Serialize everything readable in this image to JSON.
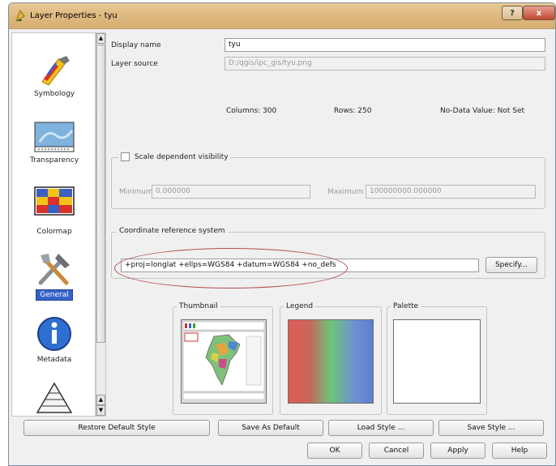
{
  "window": {
    "title": "Layer Properties - tyu",
    "help_glyph": "?",
    "close_glyph": "x"
  },
  "nav": {
    "items": [
      {
        "label": "Symbology",
        "icon": "symbology-brush-icon"
      },
      {
        "label": "Transparency",
        "icon": "transparency-map-icon"
      },
      {
        "label": "Colormap",
        "icon": "colormap-grid-icon"
      },
      {
        "label": "General",
        "icon": "general-tools-icon",
        "selected": true
      },
      {
        "label": "Metadata",
        "icon": "metadata-info-icon"
      },
      {
        "label": "",
        "icon": "pyramids-icon"
      }
    ],
    "scroll_up": "▲",
    "scroll_down": "▼"
  },
  "general": {
    "display_name_label": "Display name",
    "display_name_value": "tyu",
    "layer_source_label": "Layer source",
    "layer_source_value": "D:/qgis/ipc_gis/tyu.png",
    "columns": "Columns: 300",
    "rows": "Rows: 250",
    "nodata": "No-Data Value: Not Set",
    "scale_visibility_label": "Scale dependent visibility",
    "minimum_label": "Minimum",
    "minimum_value": "0.000000",
    "maximum_label": "Maximum",
    "maximum_value": "100000000.000000",
    "crs_label": "Coordinate reference system",
    "crs_value": "+proj=longlat +ellps=WGS84 +datum=WGS84 +no_defs",
    "specify_label": "Specify...",
    "thumbnail_label": "Thumbnail",
    "legend_label": "Legend",
    "palette_label": "Palette"
  },
  "buttons": {
    "restore": "Restore Default Style",
    "save_default": "Save As Default",
    "load_style": "Load Style ...",
    "save_style": "Save Style ...",
    "ok": "OK",
    "cancel": "Cancel",
    "apply": "Apply",
    "help": "Help"
  },
  "colors": {
    "accent_selected": "#3363c7",
    "annotation_ellipse": "#b34a4a",
    "titlebar": "#e0bb82"
  }
}
